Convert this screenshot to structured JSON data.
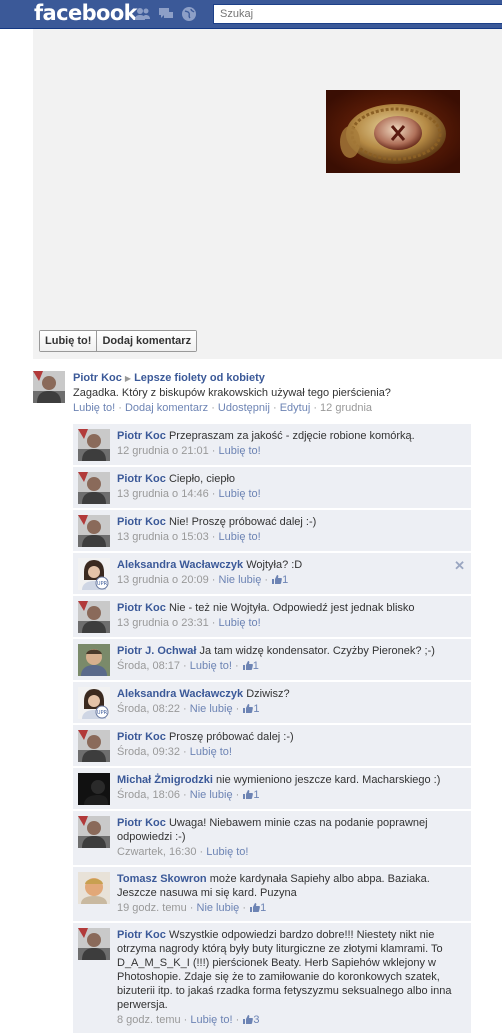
{
  "header": {
    "logo": "facebook",
    "search_placeholder": "Szukaj",
    "jewels": [
      "friend-requests-icon",
      "messages-icon",
      "notifications-icon"
    ]
  },
  "photo_panel": {
    "photo_icon": "ring-photo",
    "like_button": "Lubię to!",
    "comment_button": "Dodaj komentarz"
  },
  "post": {
    "author": "Piotr Koc",
    "target": "Lepsze fiolety od kobiety",
    "text": "Zagadka. Który z biskupów krakowskich używał tego pierścienia?",
    "actions": [
      "Lubię to!",
      "Dodaj komentarz",
      "Udostępnij",
      "Edytuj"
    ],
    "date": "12 grudnia"
  },
  "comments": [
    {
      "author": "Piotr Koc",
      "avatar": "pk",
      "text": "Przepraszam za jakość - zdjęcie robione komórką.",
      "time": "12 grudnia o 21:01",
      "action": "Lubię to!",
      "likes": ""
    },
    {
      "author": "Piotr Koc",
      "avatar": "pk",
      "text": "Ciepło, ciepło",
      "time": "13 grudnia o 14:46",
      "action": "Lubię to!",
      "likes": ""
    },
    {
      "author": "Piotr Koc",
      "avatar": "pk",
      "text": "Nie! Proszę próbować dalej :-)",
      "time": "13 grudnia o 15:03",
      "action": "Lubię to!",
      "likes": ""
    },
    {
      "author": "Aleksandra Wacławczyk",
      "avatar": "aw",
      "text": "Wojtyła? :D",
      "time": "13 grudnia o 20:09",
      "action": "Nie lubię",
      "likes": "1",
      "closable": true
    },
    {
      "author": "Piotr Koc",
      "avatar": "pk",
      "text": "Nie - też nie Wojtyła. Odpowiedź jest jednak blisko",
      "time": "13 grudnia o 23:31",
      "action": "Lubię to!",
      "likes": ""
    },
    {
      "author": "Piotr J. Ochwał",
      "avatar": "po",
      "text": "Ja tam widzę kondensator. Czyżby Pieronek? ;-)",
      "time": "Środa, 08:17",
      "action": "Lubię to!",
      "likes": "1"
    },
    {
      "author": "Aleksandra Wacławczyk",
      "avatar": "aw",
      "text": "Dziwisz?",
      "time": "Środa, 08:22",
      "action": "Nie lubię",
      "likes": "1"
    },
    {
      "author": "Piotr Koc",
      "avatar": "pk",
      "text": "Proszę próbować dalej :-)",
      "time": "Środa, 09:32",
      "action": "Lubię to!",
      "likes": ""
    },
    {
      "author": "Michał Żmigrodzki",
      "avatar": "mz",
      "text": "nie wymieniono jeszcze kard. Macharskiego :)",
      "time": "Środa, 18:06",
      "action": "Nie lubię",
      "likes": "1"
    },
    {
      "author": "Piotr Koc",
      "avatar": "pk",
      "text": "Uwaga! Niebawem minie czas na podanie poprawnej odpowiedzi :-)",
      "time": "Czwartek, 16:30",
      "action": "Lubię to!",
      "likes": ""
    },
    {
      "author": "Tomasz Skowron",
      "avatar": "ts",
      "text": "może kardynała Sapiehy albo abpa. Baziaka. Jeszcze nasuwa mi się kard. Puzyna",
      "time": "19 godz. temu",
      "action": "Nie lubię",
      "likes": "1"
    },
    {
      "author": "Piotr Koc",
      "avatar": "pk",
      "text": "Wszystkie odpowiedzi bardzo dobre!!! Niestety nikt nie otrzyma nagrody którą były buty liturgiczne ze złotymi klamrami. To D_A_M_S_K_I (!!!) pierścionek Beaty. Herb Sapiehów wklejony w Photoshopie. Zdaje się że to zamiłowanie do koronkowych szatek, bizuterii itp. to jakaś rzadka forma fetyszyzmu seksualnego albo inna perwersja.",
      "time": "8 godz. temu",
      "action": "Lubię to!",
      "likes": "3"
    }
  ],
  "colors": {
    "brand": "#3b5998",
    "comment_bg": "#edeff4",
    "photo_bg": "#f2f2f2"
  }
}
